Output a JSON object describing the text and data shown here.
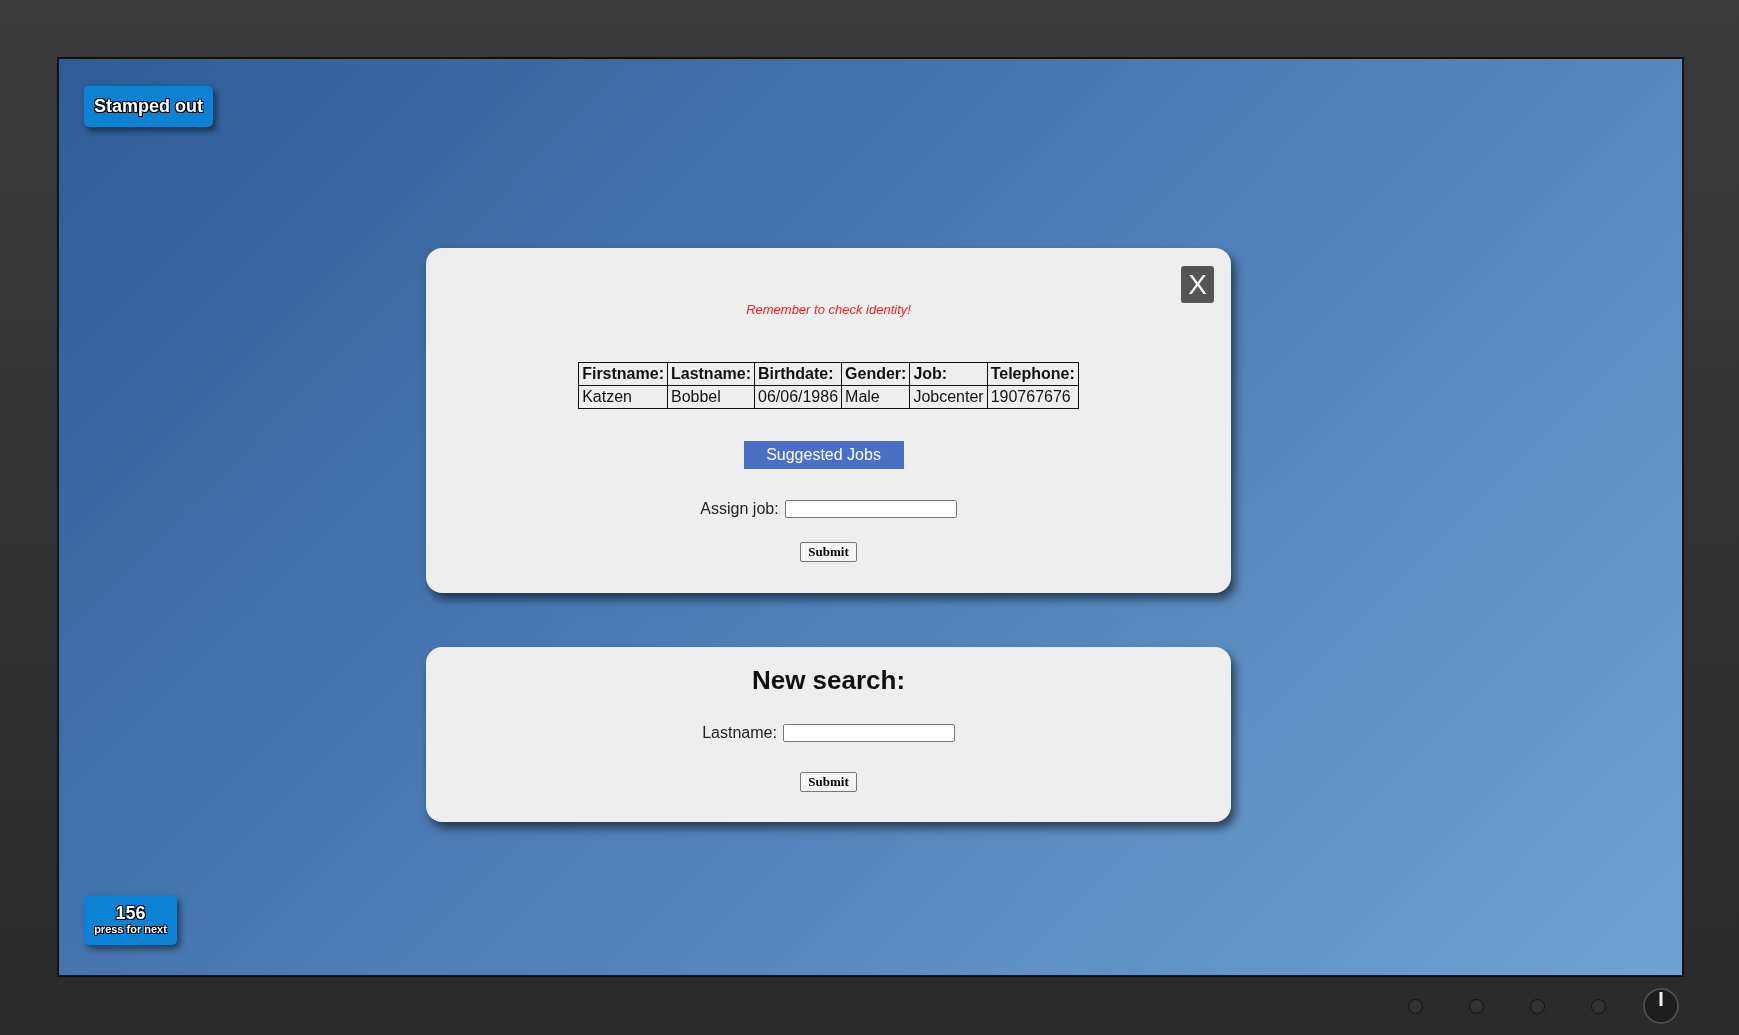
{
  "top_button": {
    "label": "Stamped out"
  },
  "record_dialog": {
    "close_label": "X",
    "warning": "Remember to check identity!",
    "table": {
      "columns": [
        "Firstname:",
        "Lastname:",
        "Birthdate:",
        "Gender:",
        "Job:",
        "Telephone:"
      ],
      "rows": [
        [
          "Katzen",
          "Bobbel",
          "06/06/1986",
          "Male",
          "Jobcenter",
          "190767676"
        ]
      ]
    },
    "suggest_button": "Suggested Jobs",
    "field_label": "Assign job:",
    "submit": "Submit"
  },
  "search_dialog": {
    "title": "New search:",
    "field_label": "Lastname:",
    "submit": "Submit"
  },
  "counter_button": {
    "count": "156",
    "caption": "press for next"
  }
}
